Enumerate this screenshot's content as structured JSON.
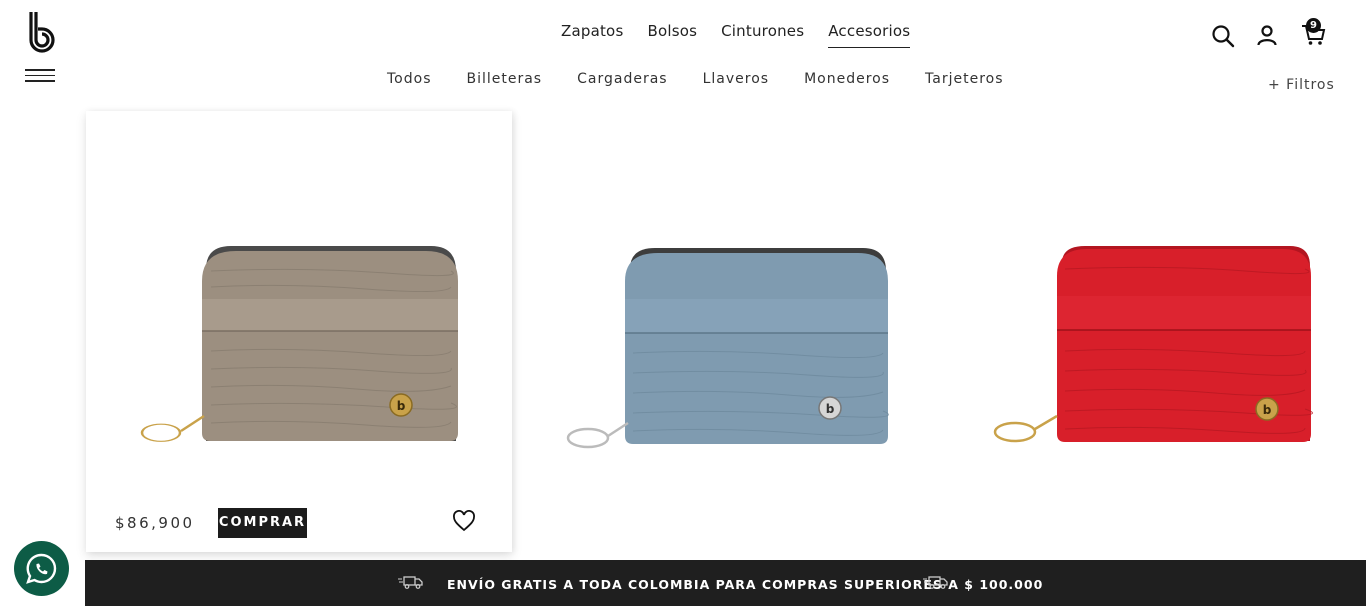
{
  "header": {
    "main_nav": [
      {
        "label": "Zapatos"
      },
      {
        "label": "Bolsos"
      },
      {
        "label": "Cinturones"
      },
      {
        "label": "Accesorios",
        "active": true
      }
    ],
    "sub_nav": [
      {
        "label": "Todos"
      },
      {
        "label": "Billeteras"
      },
      {
        "label": "Cargaderas"
      },
      {
        "label": "Llaveros"
      },
      {
        "label": "Monederos"
      },
      {
        "label": "Tarjeteros"
      }
    ],
    "filters_label": "+ Filtros",
    "cart_count": "9"
  },
  "products": [
    {
      "color_name": "taupe-metallic",
      "color": "#9c8f80",
      "price": "$86,900",
      "buy_label": "COMPRAR"
    },
    {
      "color_name": "blue-gray",
      "color": "#7f9bb0"
    },
    {
      "color_name": "red",
      "color": "#d81f2a"
    }
  ],
  "shipping_banner": "ENVÍO GRATIS A TODA COLOMBIA PARA COMPRAS SUPERIORES A $ 100.000",
  "colors": {
    "dark": "#1f1f1f",
    "whatsapp": "#0d5c46"
  }
}
